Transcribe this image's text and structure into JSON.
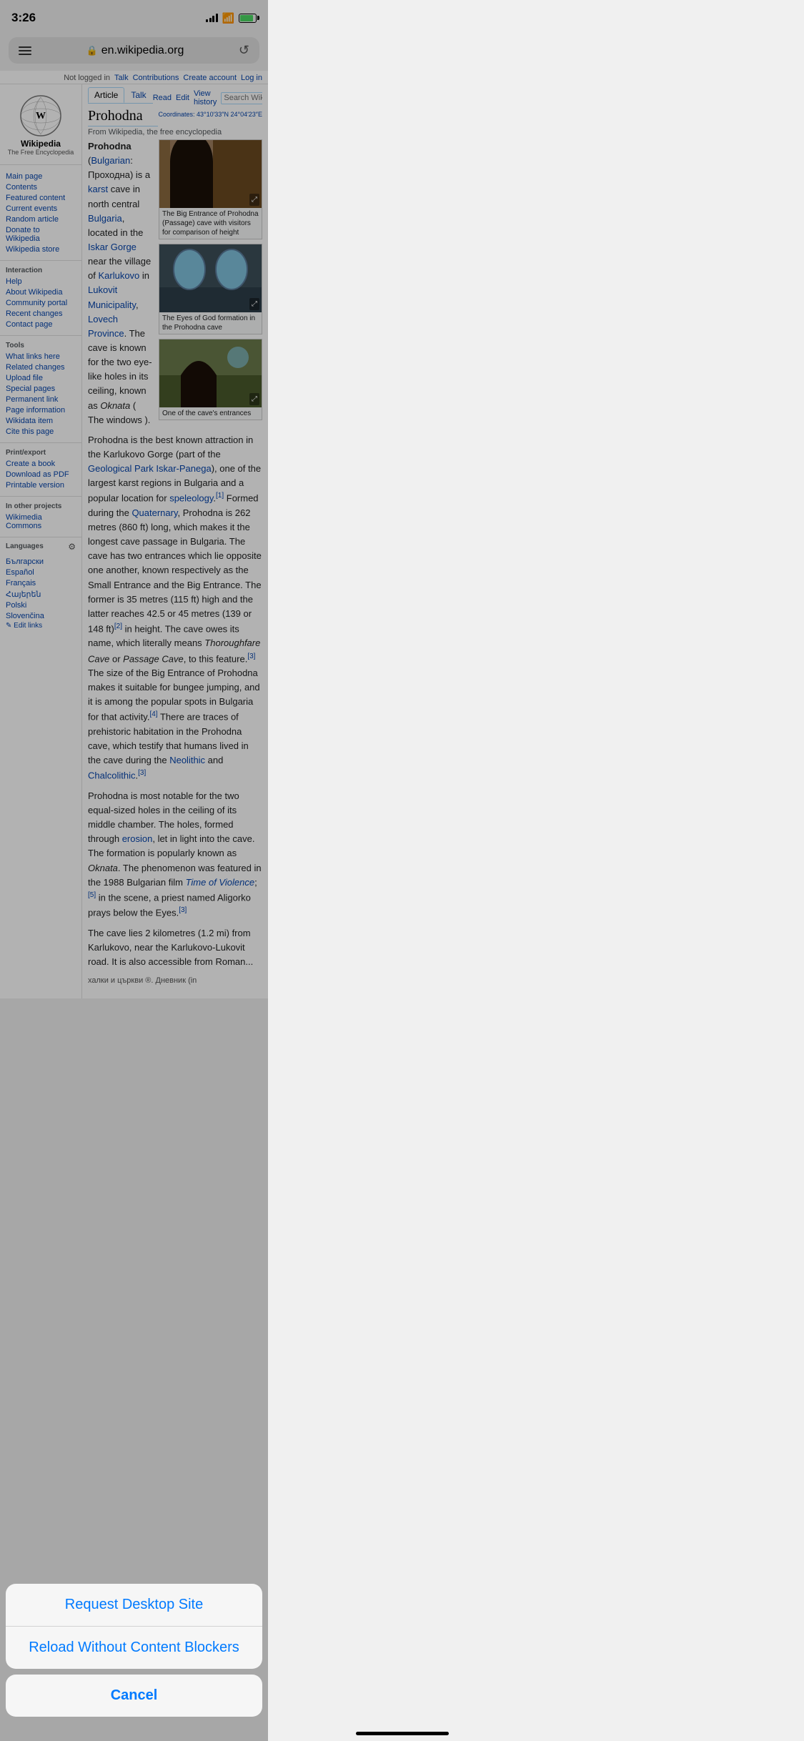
{
  "statusBar": {
    "time": "3:26",
    "url": "en.wikipedia.org"
  },
  "browser": {
    "url_display": "en.wikipedia.org",
    "reload_label": "↺"
  },
  "wikiTopBar": {
    "not_logged_in": "Not logged in",
    "talk": "Talk",
    "contributions": "Contributions",
    "create_account": "Create account",
    "log_in": "Log in"
  },
  "wikiTabs": {
    "article": "Article",
    "talk": "Talk",
    "read": "Read",
    "edit": "Edit",
    "view_history": "View history",
    "search_placeholder": "Search Wikipedia"
  },
  "wikiPage": {
    "title": "Prohodna",
    "from_line": "From Wikipedia, the free encyclopedia",
    "coordinates": "Coordinates: 43°10′33″N 24°04′23″E"
  },
  "sidebar": {
    "logo_alt": "Wikipedia globe",
    "brand_name": "Wikipedia",
    "brand_sub": "The Free Encyclopedia",
    "navigation_title": "",
    "links": {
      "main_page": "Main page",
      "contents": "Contents",
      "featured_content": "Featured content",
      "current_events": "Current events",
      "random_article": "Random article",
      "donate": "Donate to Wikipedia",
      "wikipedia_store": "Wikipedia store"
    },
    "interaction_title": "Interaction",
    "interaction_links": {
      "help": "Help",
      "about": "About Wikipedia",
      "community_portal": "Community portal",
      "recent_changes": "Recent changes",
      "contact": "Contact page"
    },
    "tools_title": "Tools",
    "tools_links": {
      "what_links": "What links here",
      "related_changes": "Related changes",
      "upload_file": "Upload file",
      "special_pages": "Special pages",
      "permanent_link": "Permanent link",
      "page_information": "Page information",
      "wikidata_item": "Wikidata item",
      "cite": "Cite this page"
    },
    "print_title": "Print/export",
    "print_links": {
      "create_book": "Create a book",
      "download_pdf": "Download as PDF",
      "printable": "Printable version"
    },
    "other_title": "In other projects",
    "other_links": {
      "wikimedia": "Wikimedia Commons"
    },
    "languages_title": "Languages",
    "lang_links": [
      "Български",
      "Español",
      "Français",
      "Հայերեն",
      "Polski",
      "Slovenčina"
    ],
    "edit_links": "✎ Edit links"
  },
  "images": [
    {
      "caption": "The Big Entrance of Prohodna (Passage) cave with visitors for comparison of height",
      "type": "cave-entrance-img"
    },
    {
      "caption": "The Eyes of God formation in the Prohodna cave",
      "type": "eyes-god-img"
    },
    {
      "caption": "One of the cave's entrances",
      "type": "cave-entrance2-img"
    }
  ],
  "content": {
    "para1_bold": "Prohodna",
    "para1": " (Bulgarian: Проходна) is a karst cave in north central Bulgaria, located in the Iskar Gorge near the village of Karlukovo in Lukovit Municipality, Lovech Province. The cave is known for the two eye-like holes in its ceiling, known as Oknata ( The windows ).",
    "para2": "Prohodna is the best known attraction in the Karlukovo Gorge (part of the Geological Park Iskar-Panega), one of the largest karst regions in Bulgaria and a popular location for speleology.[1] Formed during the Quaternary, Prohodna is 262 metres (860 ft) long, which makes it the longest cave passage in Bulgaria. The cave has two entrances which lie opposite one another, known respectively as the Small Entrance and the Big Entrance. The former is 35 metres (115 ft) high and the latter reaches 42.5 or 45 metres (139 or 148 ft)[2] in height. The cave owes its name, which literally means Thoroughfare Cave or Passage Cave, to this feature.[3] The size of the Big Entrance of Prohodna makes it suitable for bungee jumping, and it is among the popular spots in Bulgaria for that activity.[4] There are traces of prehistoric habitation in the Prohodna cave, which testify that humans lived in the cave during the Neolithic and Chalcolithic.[3]",
    "para3": "Prohodna is most notable for the two equal-sized holes in the ceiling of its middle chamber. The holes, formed through erosion, let in light into the cave. The formation is popularly known as Oknata. The phenomenon was featured in the 1988 Bulgarian film Time of Violence;[5] in the scene, a priest named Aligorko prays below the Eyes.[3]",
    "para4": "The cave lies 2 kilometres (1.2 mi) from Karlukovo, near the Karlukovo-Lukovit road. It is also accessible from Roman..."
  },
  "bottomContent": {
    "text": "халки и църкви ®. Дневник (in"
  },
  "actionSheet": {
    "request_desktop": "Request Desktop Site",
    "reload_no_blockers": "Reload Without Content Blockers",
    "cancel": "Cancel"
  }
}
